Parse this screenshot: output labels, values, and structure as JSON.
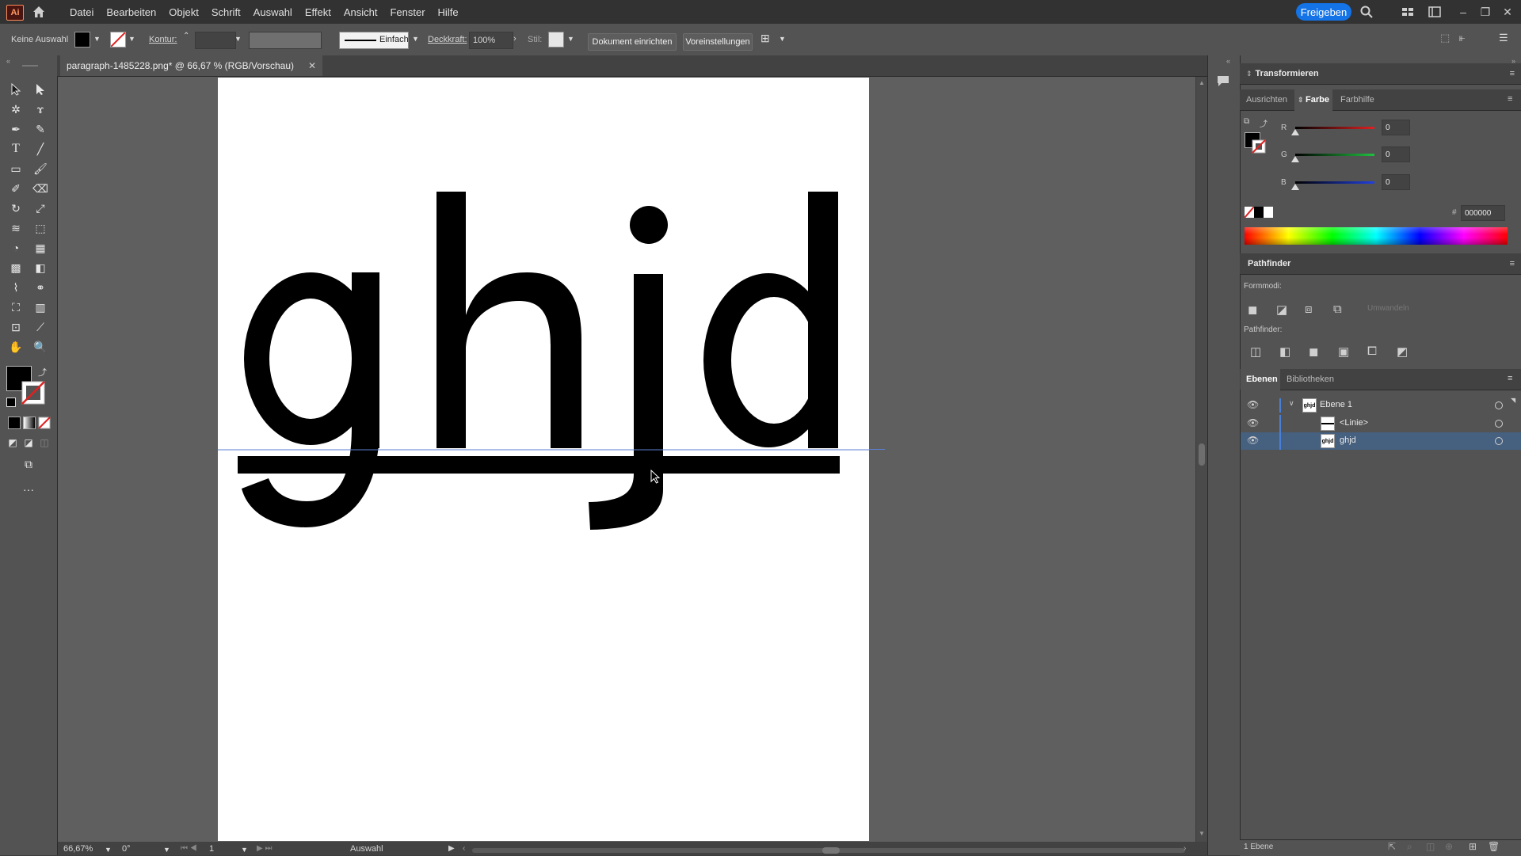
{
  "menu": {
    "app_badge": "Ai",
    "items": [
      "Datei",
      "Bearbeiten",
      "Objekt",
      "Schrift",
      "Auswahl",
      "Effekt",
      "Ansicht",
      "Fenster",
      "Hilfe"
    ],
    "share_label": "Freigeben"
  },
  "control": {
    "selection_label": "Keine Auswahl",
    "stroke_label": "Kontur:",
    "stroke_style": "Einfach",
    "opacity_label": "Deckkraft:",
    "opacity_value": "100%",
    "style_label": "Stil:",
    "setup_btn": "Dokument einrichten",
    "prefs_btn": "Voreinstellungen"
  },
  "document": {
    "tab_title": "paragraph-1485228.png* @ 66,67 % (RGB/Vorschau)",
    "artwork_text": "ghjd"
  },
  "status": {
    "zoom": "66,67%",
    "angle": "0°",
    "artboard_num": "1",
    "tool_status": "Auswahl"
  },
  "panels": {
    "transform_title": "Transformieren",
    "color_tabs": [
      "Ausrichten",
      "Farbe",
      "Farbhilfe"
    ],
    "rgb": [
      {
        "label": "R",
        "value": "0",
        "color": "#e02020"
      },
      {
        "label": "G",
        "value": "0",
        "color": "#20c040"
      },
      {
        "label": "B",
        "value": "0",
        "color": "#2040e0"
      }
    ],
    "hex_value": "000000",
    "pathfinder_title": "Pathfinder",
    "shape_modes_label": "Formmodi:",
    "expand_btn": "Umwandeln",
    "pathfinder_label": "Pathfinder:",
    "layers_tabs": [
      "Ebenen",
      "Bibliotheken"
    ],
    "layers": [
      {
        "name": "Ebene 1",
        "thumb": "ghjd"
      },
      {
        "name": "<Linie>"
      },
      {
        "name": "ghjd",
        "thumb": "ghjd"
      }
    ],
    "layers_count": "1 Ebene"
  },
  "colors": {
    "accent": "#1473e6",
    "selection_row": "#46607f",
    "layer_color": "#4a7fd6"
  }
}
